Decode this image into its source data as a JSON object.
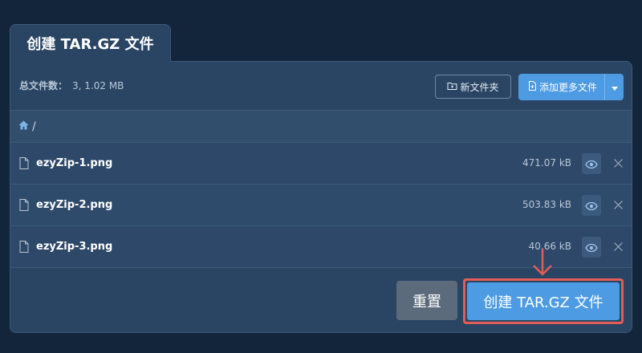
{
  "tab": {
    "title": "创建 TAR.GZ 文件"
  },
  "toolbar": {
    "total_label": "总文件数：",
    "total_value": "3, 1.02 MB",
    "new_folder_label": "新文件夹",
    "add_files_label": "添加更多文件"
  },
  "breadcrumb": {
    "path": "/"
  },
  "files": [
    {
      "name": "ezyZip-1.png",
      "size": "471.07 kB"
    },
    {
      "name": "ezyZip-2.png",
      "size": "503.83 kB"
    },
    {
      "name": "ezyZip-3.png",
      "size": "40.66 kB"
    }
  ],
  "actions": {
    "reset_label": "重置",
    "create_label": "创建 TAR.GZ 文件"
  },
  "icons": {
    "home": "home-icon",
    "file": "file-icon",
    "eye": "eye-icon",
    "close": "close-icon",
    "folder_plus": "folder-plus-icon",
    "file_plus": "file-plus-icon",
    "caret": "caret-down-icon",
    "arrow": "arrow-down-icon"
  },
  "colors": {
    "accent": "#4d9be3",
    "highlight": "#e25d57",
    "background": "#13253a",
    "panel": "#2a4563"
  }
}
